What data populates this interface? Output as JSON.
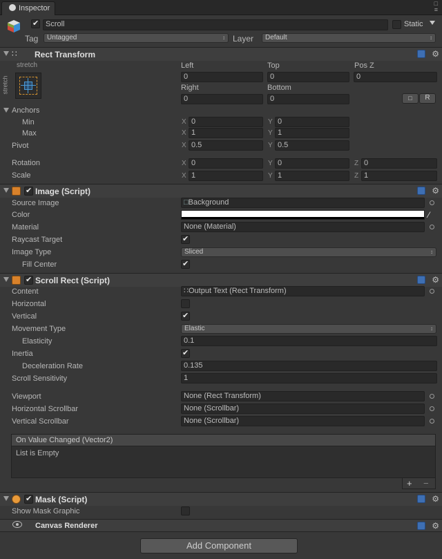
{
  "window": {
    "tab_label": "Inspector"
  },
  "object": {
    "name": "Scroll",
    "static_label": "Static",
    "tag_label": "Tag",
    "tag_value": "Untagged",
    "layer_label": "Layer",
    "layer_value": "Default"
  },
  "rect_transform": {
    "title": "Rect Transform",
    "stretch_h": "stretch",
    "stretch_v": "stretch",
    "col1": "Left",
    "col2": "Top",
    "col3": "Pos Z",
    "left": "0",
    "top": "0",
    "pos_z": "0",
    "col4": "Right",
    "col5": "Bottom",
    "right": "0",
    "bottom": "0",
    "r_button": "R",
    "anchors_label": "Anchors",
    "min_label": "Min",
    "max_label": "Max",
    "pivot_label": "Pivot",
    "rotation_label": "Rotation",
    "scale_label": "Scale",
    "anchor_min_x": "0",
    "anchor_min_y": "0",
    "anchor_max_x": "1",
    "anchor_max_y": "1",
    "pivot_x": "0.5",
    "pivot_y": "0.5",
    "rot_x": "0",
    "rot_y": "0",
    "rot_z": "0",
    "scale_x": "1",
    "scale_y": "1",
    "scale_z": "1",
    "x": "X",
    "y": "Y",
    "z": "Z"
  },
  "image": {
    "title": "Image (Script)",
    "source_label": "Source Image",
    "source_value": "Background",
    "color_label": "Color",
    "material_label": "Material",
    "material_value": "None (Material)",
    "raycast_label": "Raycast Target",
    "type_label": "Image Type",
    "type_value": "Sliced",
    "fill_label": "Fill Center"
  },
  "scroll_rect": {
    "title": "Scroll Rect (Script)",
    "content_label": "Content",
    "content_value": "Output Text (Rect Transform)",
    "horizontal_label": "Horizontal",
    "vertical_label": "Vertical",
    "movement_label": "Movement Type",
    "movement_value": "Elastic",
    "elasticity_label": "Elasticity",
    "elasticity_value": "0.1",
    "inertia_label": "Inertia",
    "decel_label": "Deceleration Rate",
    "decel_value": "0.135",
    "sensitivity_label": "Scroll Sensitivity",
    "sensitivity_value": "1",
    "viewport_label": "Viewport",
    "viewport_value": "None (Rect Transform)",
    "hscroll_label": "Horizontal Scrollbar",
    "hscroll_value": "None (Scrollbar)",
    "vscroll_label": "Vertical Scrollbar",
    "vscroll_value": "None (Scrollbar)",
    "event_title": "On Value Changed (Vector2)",
    "event_empty": "List is Empty",
    "plus": "+",
    "minus": "−"
  },
  "mask": {
    "title": "Mask (Script)",
    "show_label": "Show Mask Graphic"
  },
  "canvas_renderer": {
    "title": "Canvas Renderer"
  },
  "footer": {
    "add_component": "Add Component"
  }
}
